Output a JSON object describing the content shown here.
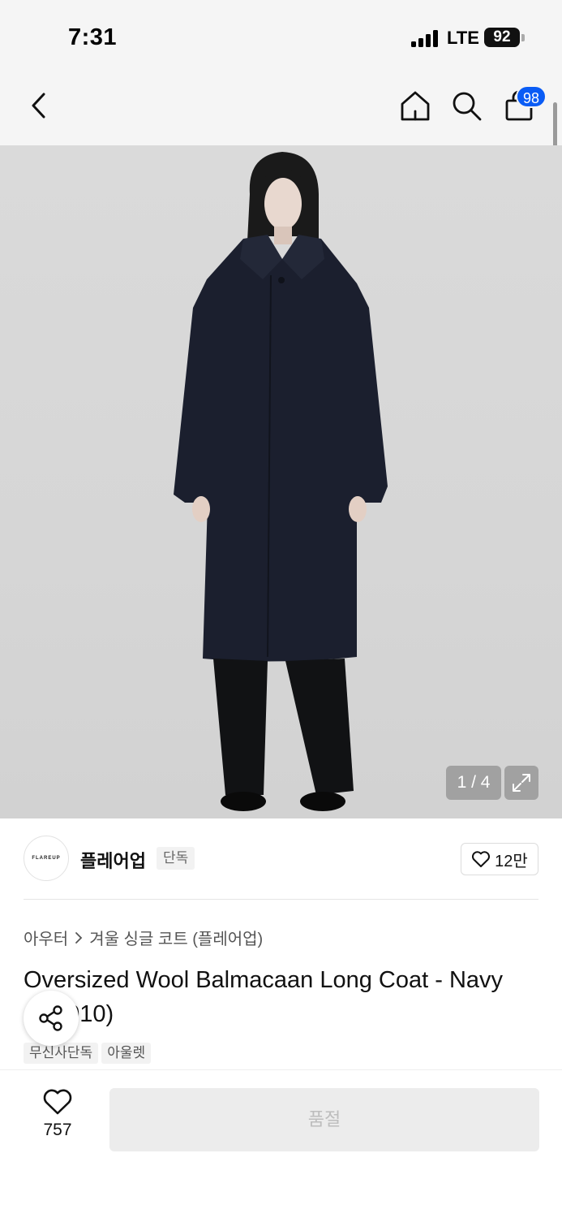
{
  "status_bar": {
    "time": "7:31",
    "network": "LTE",
    "battery": "92"
  },
  "nav": {
    "cart_count": "98"
  },
  "gallery": {
    "pager": "1 / 4"
  },
  "brand": {
    "logo_text": "FLAREUP",
    "name": "플레어업",
    "tag": "단독",
    "like_count": "12만"
  },
  "product": {
    "breadcrumb": [
      "아우터",
      "겨울 싱글 코트 (플레어업)"
    ],
    "title": "Oversized Wool Balmacaan Long Coat - Navy (FL-010)",
    "badges": [
      "무신사단독",
      "아울렛"
    ]
  },
  "bottom": {
    "wish_count": "757",
    "button_label": "품절"
  },
  "colors": {
    "accent": "#0a5cf5",
    "background": "#f5f5f5",
    "disabled": "#ececec"
  }
}
